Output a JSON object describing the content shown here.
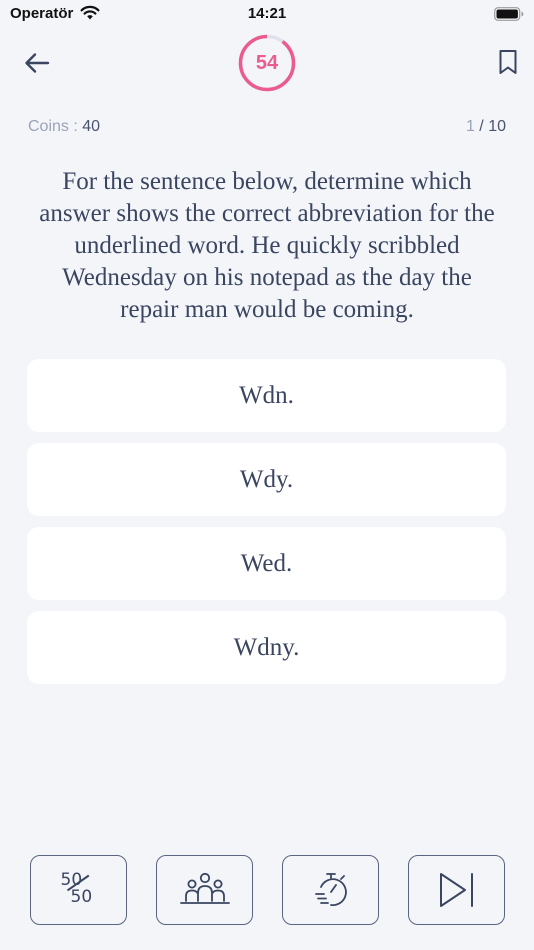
{
  "status_bar": {
    "carrier": "Operatör",
    "time": "14:21"
  },
  "header": {
    "timer_value": "54",
    "timer_progress": 0.9
  },
  "meta": {
    "coins_label": "Coins : ",
    "coins_value": "40",
    "current_question": "1",
    "separator": " / ",
    "total_questions": "10"
  },
  "question": {
    "text": "For the sentence below, determine which answer shows the correct abbreviation for the underlined word. He quickly scribbled Wednesday on his notepad as the day the repair man would be coming."
  },
  "answers": [
    {
      "label": "Wdn."
    },
    {
      "label": "Wdy."
    },
    {
      "label": "Wed."
    },
    {
      "label": "Wdny."
    }
  ],
  "lifelines": {
    "fifty_top": "50",
    "fifty_bottom": "50"
  },
  "colors": {
    "accent": "#ec5b8d",
    "text": "#3a4560",
    "background": "#f3f5f9",
    "card": "#ffffff",
    "muted": "#9aa3b6"
  },
  "icons": {
    "back": "arrow-left-icon",
    "bookmark": "bookmark-icon",
    "fifty": "fifty-fifty-icon",
    "audience": "audience-icon",
    "time": "stopwatch-icon",
    "skip": "skip-icon"
  }
}
